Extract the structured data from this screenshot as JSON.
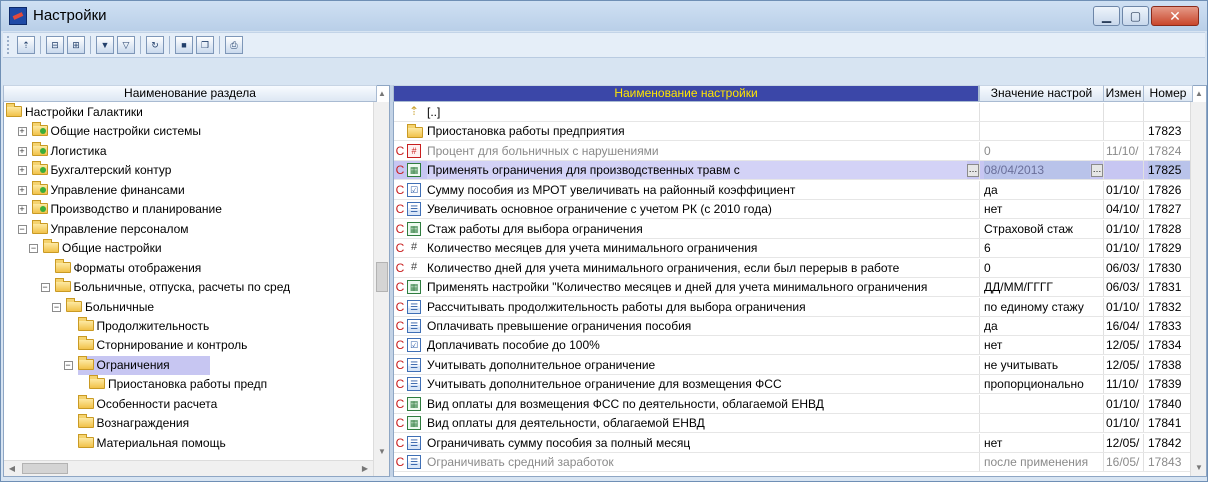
{
  "window": {
    "title": "Настройки"
  },
  "left": {
    "header": "Наименование раздела",
    "rows": [
      {
        "label": "Настройки Галактики",
        "indent": 0,
        "exp": "",
        "green": false,
        "sel": false
      },
      {
        "label": "Общие настройки системы",
        "indent": 1,
        "exp": "+",
        "green": true,
        "sel": false
      },
      {
        "label": "Логистика",
        "indent": 1,
        "exp": "+",
        "green": true,
        "sel": false
      },
      {
        "label": "Бухгалтерский контур",
        "indent": 1,
        "exp": "+",
        "green": true,
        "sel": false
      },
      {
        "label": "Управление финансами",
        "indent": 1,
        "exp": "+",
        "green": true,
        "sel": false
      },
      {
        "label": "Производство и планирование",
        "indent": 1,
        "exp": "+",
        "green": true,
        "sel": false
      },
      {
        "label": "Управление персоналом",
        "indent": 1,
        "exp": "−",
        "green": false,
        "sel": false
      },
      {
        "label": "Общие настройки",
        "indent": 2,
        "exp": "−",
        "green": false,
        "sel": false
      },
      {
        "label": "Форматы отображения",
        "indent": 3,
        "exp": "",
        "green": false,
        "sel": false
      },
      {
        "label": "Больничные, отпуска, расчеты по сред",
        "indent": 3,
        "exp": "−",
        "green": false,
        "sel": false
      },
      {
        "label": "Больничные",
        "indent": 4,
        "exp": "−",
        "green": false,
        "sel": false
      },
      {
        "label": "Продолжительность",
        "indent": 5,
        "exp": "",
        "green": false,
        "sel": false
      },
      {
        "label": "Сторнирование и контроль",
        "indent": 5,
        "exp": "",
        "green": false,
        "sel": false
      },
      {
        "label": "Ограничения",
        "indent": 5,
        "exp": "−",
        "green": false,
        "sel": true
      },
      {
        "label": "Приостановка работы предп",
        "indent": 6,
        "exp": "",
        "green": false,
        "sel": false
      },
      {
        "label": "Особенности расчета",
        "indent": 5,
        "exp": "",
        "green": false,
        "sel": false
      },
      {
        "label": "Вознаграждения",
        "indent": 5,
        "exp": "",
        "green": false,
        "sel": false
      },
      {
        "label": "Материальная помощь",
        "indent": 5,
        "exp": "",
        "green": false,
        "sel": false
      }
    ]
  },
  "right": {
    "columns": {
      "name": "Наименование настройки",
      "value": "Значение настрой",
      "changed": "Измен",
      "number": "Номер"
    },
    "rows": [
      {
        "marker": "",
        "icon": "up",
        "name": "[..]",
        "value": "",
        "changed": "",
        "number": "",
        "grey": false,
        "sel": false
      },
      {
        "marker": "",
        "icon": "folder",
        "name": "Приостановка работы предприятия",
        "value": "",
        "changed": "",
        "number": "17823",
        "grey": false,
        "sel": false
      },
      {
        "marker": "C",
        "icon": "mark",
        "name": "Процент для больничных с нарушениями",
        "value": "0",
        "changed": "11/10/",
        "number": "17824",
        "grey": true,
        "sel": false
      },
      {
        "marker": "C",
        "icon": "calc",
        "name": "Применять ограничения для производственных травм с",
        "value": "08/04/2013",
        "changed": "",
        "number": "17825",
        "grey": false,
        "sel": true
      },
      {
        "marker": "C",
        "icon": "check",
        "name": "Сумму пособия из МРОТ увеличивать на районный коэффициент",
        "value": "да",
        "changed": "01/10/",
        "number": "17826",
        "grey": false,
        "sel": false
      },
      {
        "marker": "C",
        "icon": "doc",
        "name": "Увеличивать основное ограничение с учетом РК (с 2010 года)",
        "value": "нет",
        "changed": "04/10/",
        "number": "17827",
        "grey": false,
        "sel": false
      },
      {
        "marker": "C",
        "icon": "calc",
        "name": "Стаж работы для выбора ограничения",
        "value": "Страховой стаж",
        "changed": "01/10/",
        "number": "17828",
        "grey": false,
        "sel": false
      },
      {
        "marker": "C",
        "icon": "hash",
        "name": "Количество месяцев для учета минимального ограничения",
        "value": "6",
        "changed": "01/10/",
        "number": "17829",
        "grey": false,
        "sel": false
      },
      {
        "marker": "C",
        "icon": "hash",
        "name": "Количество дней для учета минимального ограничения, если был перерыв в работе",
        "value": "0",
        "changed": "06/03/",
        "number": "17830",
        "grey": false,
        "sel": false
      },
      {
        "marker": "C",
        "icon": "calc",
        "name": "Применять настройки \"Количество месяцев и дней для учета минимального ограничения",
        "value": "ДД/ММ/ГГГГ",
        "changed": "06/03/",
        "number": "17831",
        "grey": false,
        "sel": false
      },
      {
        "marker": "C",
        "icon": "doc",
        "name": "Рассчитывать продолжительность работы для выбора ограничения",
        "value": "по единому стажу",
        "changed": "01/10/",
        "number": "17832",
        "grey": false,
        "sel": false
      },
      {
        "marker": "C",
        "icon": "doc",
        "name": "Оплачивать превышение ограничения пособия",
        "value": "да",
        "changed": "16/04/",
        "number": "17833",
        "grey": false,
        "sel": false
      },
      {
        "marker": "C",
        "icon": "check",
        "name": "Доплачивать пособие до 100%",
        "value": "нет",
        "changed": "12/05/",
        "number": "17834",
        "grey": false,
        "sel": false
      },
      {
        "marker": "C",
        "icon": "doc",
        "name": "Учитывать дополнительное ограничение",
        "value": "не учитывать",
        "changed": "12/05/",
        "number": "17838",
        "grey": false,
        "sel": false
      },
      {
        "marker": "C",
        "icon": "doc",
        "name": "Учитывать дополнительное ограничение для возмещения ФСС",
        "value": "пропорционально",
        "changed": "11/10/",
        "number": "17839",
        "grey": false,
        "sel": false
      },
      {
        "marker": "C",
        "icon": "calc",
        "name": "Вид оплаты для возмещения ФСС по деятельности, облагаемой ЕНВД",
        "value": "",
        "changed": "01/10/",
        "number": "17840",
        "grey": false,
        "sel": false
      },
      {
        "marker": "C",
        "icon": "calc",
        "name": "Вид оплаты для деятельности, облагаемой ЕНВД",
        "value": "",
        "changed": "01/10/",
        "number": "17841",
        "grey": false,
        "sel": false
      },
      {
        "marker": "C",
        "icon": "doc",
        "name": "Ограничивать сумму пособия за полный месяц",
        "value": "нет",
        "changed": "12/05/",
        "number": "17842",
        "grey": false,
        "sel": false
      },
      {
        "marker": "C",
        "icon": "doc",
        "name": "Ограничивать средний заработок",
        "value": "после применения",
        "changed": "16/05/",
        "number": "17843",
        "grey": true,
        "sel": false
      }
    ]
  }
}
